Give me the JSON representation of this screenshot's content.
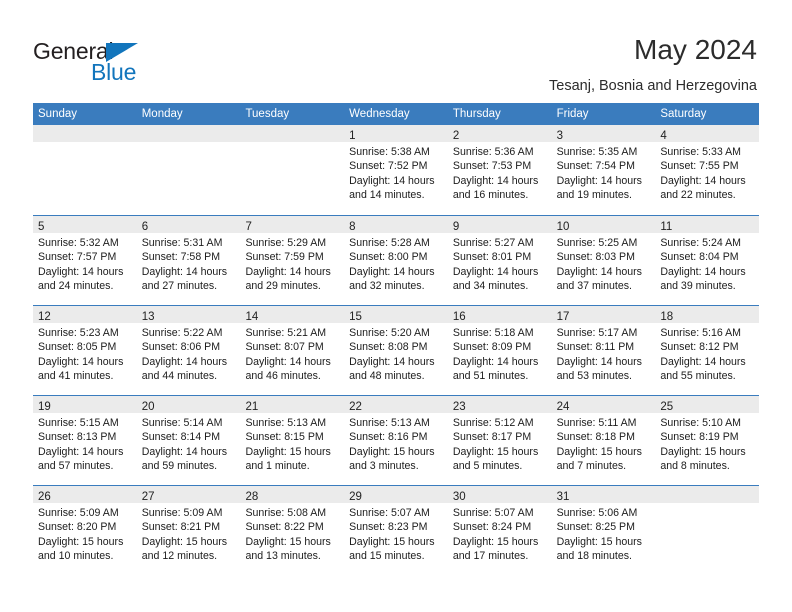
{
  "brand": {
    "name_part1": "General",
    "name_part2": "Blue",
    "triangle_color": "#1275bc"
  },
  "header": {
    "title": "May 2024",
    "subtitle": "Tesanj, Bosnia and Herzegovina"
  },
  "theme": {
    "header_blue": "#3a7cbe",
    "daynum_band": "#ebebeb",
    "text": "#1c1c1c"
  },
  "calendar": {
    "weekdays": [
      "Sunday",
      "Monday",
      "Tuesday",
      "Wednesday",
      "Thursday",
      "Friday",
      "Saturday"
    ],
    "weeks": [
      [
        {
          "day": "",
          "sunrise": "",
          "sunset": "",
          "daylight_line1": "",
          "daylight_line2": "",
          "empty": true
        },
        {
          "day": "",
          "sunrise": "",
          "sunset": "",
          "daylight_line1": "",
          "daylight_line2": "",
          "empty": true
        },
        {
          "day": "",
          "sunrise": "",
          "sunset": "",
          "daylight_line1": "",
          "daylight_line2": "",
          "empty": true
        },
        {
          "day": "1",
          "sunrise": "Sunrise: 5:38 AM",
          "sunset": "Sunset: 7:52 PM",
          "daylight_line1": "Daylight: 14 hours",
          "daylight_line2": "and 14 minutes."
        },
        {
          "day": "2",
          "sunrise": "Sunrise: 5:36 AM",
          "sunset": "Sunset: 7:53 PM",
          "daylight_line1": "Daylight: 14 hours",
          "daylight_line2": "and 16 minutes."
        },
        {
          "day": "3",
          "sunrise": "Sunrise: 5:35 AM",
          "sunset": "Sunset: 7:54 PM",
          "daylight_line1": "Daylight: 14 hours",
          "daylight_line2": "and 19 minutes."
        },
        {
          "day": "4",
          "sunrise": "Sunrise: 5:33 AM",
          "sunset": "Sunset: 7:55 PM",
          "daylight_line1": "Daylight: 14 hours",
          "daylight_line2": "and 22 minutes."
        }
      ],
      [
        {
          "day": "5",
          "sunrise": "Sunrise: 5:32 AM",
          "sunset": "Sunset: 7:57 PM",
          "daylight_line1": "Daylight: 14 hours",
          "daylight_line2": "and 24 minutes."
        },
        {
          "day": "6",
          "sunrise": "Sunrise: 5:31 AM",
          "sunset": "Sunset: 7:58 PM",
          "daylight_line1": "Daylight: 14 hours",
          "daylight_line2": "and 27 minutes."
        },
        {
          "day": "7",
          "sunrise": "Sunrise: 5:29 AM",
          "sunset": "Sunset: 7:59 PM",
          "daylight_line1": "Daylight: 14 hours",
          "daylight_line2": "and 29 minutes."
        },
        {
          "day": "8",
          "sunrise": "Sunrise: 5:28 AM",
          "sunset": "Sunset: 8:00 PM",
          "daylight_line1": "Daylight: 14 hours",
          "daylight_line2": "and 32 minutes."
        },
        {
          "day": "9",
          "sunrise": "Sunrise: 5:27 AM",
          "sunset": "Sunset: 8:01 PM",
          "daylight_line1": "Daylight: 14 hours",
          "daylight_line2": "and 34 minutes."
        },
        {
          "day": "10",
          "sunrise": "Sunrise: 5:25 AM",
          "sunset": "Sunset: 8:03 PM",
          "daylight_line1": "Daylight: 14 hours",
          "daylight_line2": "and 37 minutes."
        },
        {
          "day": "11",
          "sunrise": "Sunrise: 5:24 AM",
          "sunset": "Sunset: 8:04 PM",
          "daylight_line1": "Daylight: 14 hours",
          "daylight_line2": "and 39 minutes."
        }
      ],
      [
        {
          "day": "12",
          "sunrise": "Sunrise: 5:23 AM",
          "sunset": "Sunset: 8:05 PM",
          "daylight_line1": "Daylight: 14 hours",
          "daylight_line2": "and 41 minutes."
        },
        {
          "day": "13",
          "sunrise": "Sunrise: 5:22 AM",
          "sunset": "Sunset: 8:06 PM",
          "daylight_line1": "Daylight: 14 hours",
          "daylight_line2": "and 44 minutes."
        },
        {
          "day": "14",
          "sunrise": "Sunrise: 5:21 AM",
          "sunset": "Sunset: 8:07 PM",
          "daylight_line1": "Daylight: 14 hours",
          "daylight_line2": "and 46 minutes."
        },
        {
          "day": "15",
          "sunrise": "Sunrise: 5:20 AM",
          "sunset": "Sunset: 8:08 PM",
          "daylight_line1": "Daylight: 14 hours",
          "daylight_line2": "and 48 minutes."
        },
        {
          "day": "16",
          "sunrise": "Sunrise: 5:18 AM",
          "sunset": "Sunset: 8:09 PM",
          "daylight_line1": "Daylight: 14 hours",
          "daylight_line2": "and 51 minutes."
        },
        {
          "day": "17",
          "sunrise": "Sunrise: 5:17 AM",
          "sunset": "Sunset: 8:11 PM",
          "daylight_line1": "Daylight: 14 hours",
          "daylight_line2": "and 53 minutes."
        },
        {
          "day": "18",
          "sunrise": "Sunrise: 5:16 AM",
          "sunset": "Sunset: 8:12 PM",
          "daylight_line1": "Daylight: 14 hours",
          "daylight_line2": "and 55 minutes."
        }
      ],
      [
        {
          "day": "19",
          "sunrise": "Sunrise: 5:15 AM",
          "sunset": "Sunset: 8:13 PM",
          "daylight_line1": "Daylight: 14 hours",
          "daylight_line2": "and 57 minutes."
        },
        {
          "day": "20",
          "sunrise": "Sunrise: 5:14 AM",
          "sunset": "Sunset: 8:14 PM",
          "daylight_line1": "Daylight: 14 hours",
          "daylight_line2": "and 59 minutes."
        },
        {
          "day": "21",
          "sunrise": "Sunrise: 5:13 AM",
          "sunset": "Sunset: 8:15 PM",
          "daylight_line1": "Daylight: 15 hours",
          "daylight_line2": "and 1 minute."
        },
        {
          "day": "22",
          "sunrise": "Sunrise: 5:13 AM",
          "sunset": "Sunset: 8:16 PM",
          "daylight_line1": "Daylight: 15 hours",
          "daylight_line2": "and 3 minutes."
        },
        {
          "day": "23",
          "sunrise": "Sunrise: 5:12 AM",
          "sunset": "Sunset: 8:17 PM",
          "daylight_line1": "Daylight: 15 hours",
          "daylight_line2": "and 5 minutes."
        },
        {
          "day": "24",
          "sunrise": "Sunrise: 5:11 AM",
          "sunset": "Sunset: 8:18 PM",
          "daylight_line1": "Daylight: 15 hours",
          "daylight_line2": "and 7 minutes."
        },
        {
          "day": "25",
          "sunrise": "Sunrise: 5:10 AM",
          "sunset": "Sunset: 8:19 PM",
          "daylight_line1": "Daylight: 15 hours",
          "daylight_line2": "and 8 minutes."
        }
      ],
      [
        {
          "day": "26",
          "sunrise": "Sunrise: 5:09 AM",
          "sunset": "Sunset: 8:20 PM",
          "daylight_line1": "Daylight: 15 hours",
          "daylight_line2": "and 10 minutes."
        },
        {
          "day": "27",
          "sunrise": "Sunrise: 5:09 AM",
          "sunset": "Sunset: 8:21 PM",
          "daylight_line1": "Daylight: 15 hours",
          "daylight_line2": "and 12 minutes."
        },
        {
          "day": "28",
          "sunrise": "Sunrise: 5:08 AM",
          "sunset": "Sunset: 8:22 PM",
          "daylight_line1": "Daylight: 15 hours",
          "daylight_line2": "and 13 minutes."
        },
        {
          "day": "29",
          "sunrise": "Sunrise: 5:07 AM",
          "sunset": "Sunset: 8:23 PM",
          "daylight_line1": "Daylight: 15 hours",
          "daylight_line2": "and 15 minutes."
        },
        {
          "day": "30",
          "sunrise": "Sunrise: 5:07 AM",
          "sunset": "Sunset: 8:24 PM",
          "daylight_line1": "Daylight: 15 hours",
          "daylight_line2": "and 17 minutes."
        },
        {
          "day": "31",
          "sunrise": "Sunrise: 5:06 AM",
          "sunset": "Sunset: 8:25 PM",
          "daylight_line1": "Daylight: 15 hours",
          "daylight_line2": "and 18 minutes."
        },
        {
          "day": "",
          "sunrise": "",
          "sunset": "",
          "daylight_line1": "",
          "daylight_line2": "",
          "empty": true
        }
      ]
    ]
  }
}
